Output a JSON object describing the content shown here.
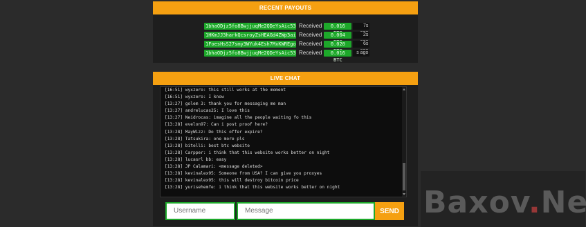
{
  "payouts": {
    "title": "RECENT PAYOUTS",
    "received_label": "Received",
    "rows": [
      {
        "address": "1bhaODjz5fo8BwjjuqMe2QDeYsAic53...",
        "amount": "0.016 BTC",
        "ago": "7s ago"
      },
      {
        "address": "1HKmJJ3harkQcsroyZsHEAGd4ZWp3ai...",
        "amount": "0.004 BTC",
        "ago": "2s ago"
      },
      {
        "address": "1FoesHsS27smy3WYuk4Esh7MxKWREgo...",
        "amount": "0.020 BTC",
        "ago": "6s ago"
      },
      {
        "address": "1bhaODjz5fo8BwjjuqMe2QDeYsAic53...",
        "amount": "0.016 BTC",
        "ago": "s ago"
      }
    ]
  },
  "chat": {
    "title": "LIVE CHAT",
    "messages": [
      "[16:51] wyxzero: this still works at the moment",
      "[16:51] wyxzero: I know",
      "[13:27] golem 3: thank you for messaging me man",
      "[13:27] andrelucas25: I love this",
      "[13:27] Neidrocas: imagine all the people waiting fo this",
      "[13:28] evelon97: Can i post proof here?",
      "[13:28] MayWizz: Do this offer expire?",
      "[13:28] Tatsukira: one more pls",
      "[13:28] bitelli: best btc website",
      "[13:28] Carpper: i think that this website works better on night",
      "[13:28] lucasrl bb: easy",
      "[13:28] JP Calamari: <message deleted>",
      "[13:28] kevinalex95: Someone from USA? I can give you proxyes",
      "[13:28] kevinalex95: this will destroy bitcoin price",
      "[13:28] yurisehemfe: i think that this website works better on night"
    ],
    "username_placeholder": "Username",
    "message_placeholder": "Message",
    "send_label": "SEND"
  },
  "watermark": {
    "text_main": "Baxov",
    "text_dot": ".",
    "text_tail": "Net"
  },
  "colors": {
    "accent": "#f5a011",
    "green": "#1da82a",
    "panel": "#1e1e1e",
    "page": "#2b2b2b"
  }
}
